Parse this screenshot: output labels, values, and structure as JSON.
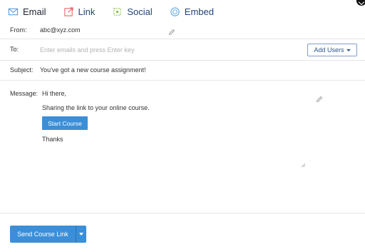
{
  "tabs": [
    {
      "label": "Email",
      "icon": "envelope-icon"
    },
    {
      "label": "Link",
      "icon": "external-link-icon"
    },
    {
      "label": "Social",
      "icon": "social-icon"
    },
    {
      "label": "Embed",
      "icon": "embed-icon"
    }
  ],
  "form": {
    "from_label": "From:",
    "from_value": "abc@xyz.com",
    "to_label": "To:",
    "to_placeholder": "Enter emails and press Enter key",
    "add_users_label": "Add Users",
    "subject_label": "Subject:",
    "subject_value": "You've got a new course assignment!",
    "message_label": "Message:"
  },
  "message": {
    "greeting": "Hi there,",
    "body": "Sharing the link to your online course.",
    "button_label": "Start Course",
    "signoff": "Thanks"
  },
  "footer": {
    "send_label": "Send Course Link"
  },
  "colors": {
    "primary": "#3b8fd8",
    "tab_text": "#23457a",
    "link_icon": "#e86a6a",
    "social_icon": "#8bc34a",
    "embed_icon": "#5fa8e6"
  }
}
